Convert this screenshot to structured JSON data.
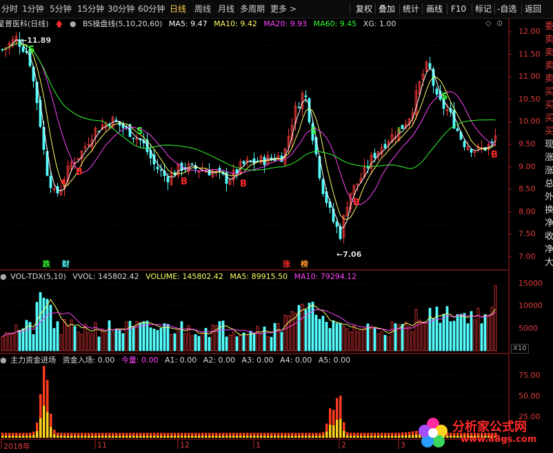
{
  "toolbar": {
    "periods": [
      "分时",
      "1分钟",
      "5分钟",
      "15分钟",
      "30分钟",
      "60分钟",
      "日线",
      "周线",
      "月线",
      "多周期",
      "更多"
    ],
    "active_period": "日线",
    "more_arrow": ">",
    "right_buttons": [
      "复权",
      "叠加",
      "统计",
      "画线",
      "F10",
      "标记",
      "-自选",
      "返回"
    ]
  },
  "main_header": {
    "stock": "星普医科(日线)",
    "indicator": "BS操盘线(5,10,20,60)",
    "ma5": "MA5: 9.47",
    "ma10": "MA10: 9.42",
    "ma20": "MA20: 9.93",
    "ma60": "MA60: 9.45",
    "xg": "XG: 1.00"
  },
  "price_axis": [
    "12.00",
    "11.50",
    "11.00",
    "10.50",
    "10.00",
    "9.50",
    "9.00",
    "8.50",
    "8.00",
    "7.50",
    "7.00"
  ],
  "annotations": {
    "high_label": "11.89",
    "low_label": "7.06",
    "news_labels": [
      "跌",
      "财",
      "涨",
      "榜"
    ]
  },
  "vol_header": {
    "name": "VOL-TDX(5,10)",
    "vvol": "VVOL: 145802.42",
    "volume": "VOLUME: 145802.42",
    "ma5": "MA5: 89915.50",
    "ma10": "MA10: 79294.12"
  },
  "vol_axis": [
    "15000",
    "10000",
    "5000"
  ],
  "vol_unit": "X10",
  "fund_header": {
    "name": "主力资金进场",
    "fund_in": "资金入场: 0.00",
    "jinliang": "今量: 0.00",
    "a1": "A1: 0.00",
    "a2": "A2: 0.00",
    "a3": "A3: 0.00",
    "a4": "A4: 0.00",
    "a5": "A5: 0.00"
  },
  "fund_axis": [
    "75.00",
    "50.00",
    "25.00"
  ],
  "date_axis": [
    "2018年",
    "11",
    "12",
    "1",
    "2",
    "3"
  ],
  "side_panel_chars": [
    "委",
    "卖",
    "卖",
    "卖",
    "卖",
    "买",
    "买",
    "买",
    "买",
    "现",
    "涨",
    "涨",
    "总",
    "外",
    "换",
    "净",
    "收",
    "净",
    "大"
  ],
  "logo": {
    "main": "分析家公式网",
    "sub": "www.88gs.com"
  },
  "colors": {
    "up": "#ff3b3b",
    "down": "#54ffff",
    "ma5": "#ffffff",
    "ma10": "#ffff66",
    "ma20": "#ff44ff",
    "ma60": "#33ff33"
  }
}
